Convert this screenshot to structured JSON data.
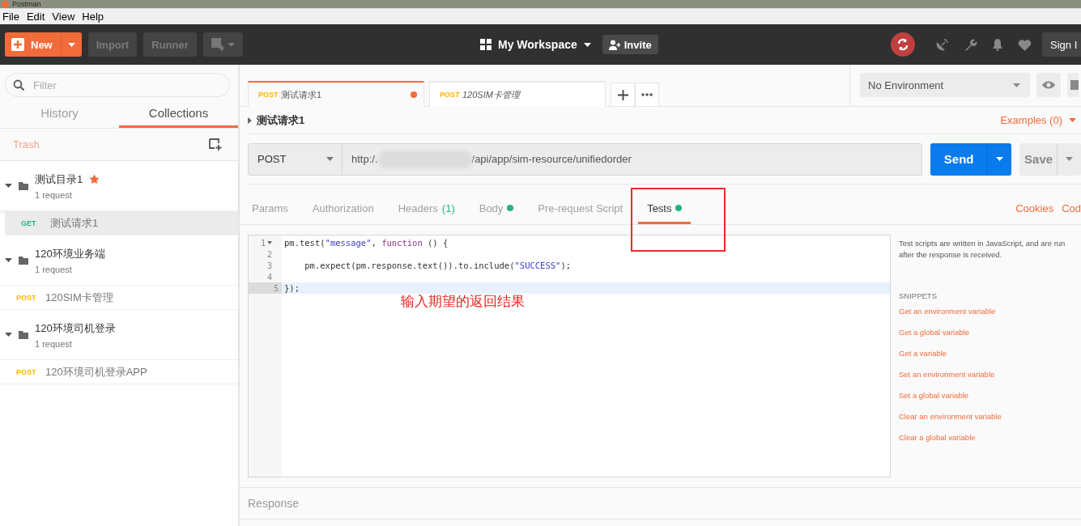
{
  "window": {
    "title": "Postman"
  },
  "menu": [
    "File",
    "Edit",
    "View",
    "Help"
  ],
  "header": {
    "new_label": "New",
    "import_label": "Import",
    "runner_label": "Runner",
    "workspace": "My Workspace",
    "invite": "Invite",
    "sign_in": "Sign I"
  },
  "sidebar": {
    "filter_placeholder": "Filter",
    "tabs": [
      {
        "label": "History",
        "selected": false
      },
      {
        "label": "Collections",
        "selected": true
      }
    ],
    "trash": "Trash",
    "collections": [
      {
        "name": "测试目录1",
        "starred": true,
        "count": "1 request",
        "expanded": true,
        "children": [
          {
            "method": "GET",
            "name": "测试请求1",
            "selected": true
          }
        ]
      },
      {
        "name": "120环境业务端",
        "starred": false,
        "count": "1 request",
        "expanded": true,
        "children": [
          {
            "method": "POST",
            "name": "120SIM卡管理",
            "selected": false
          }
        ]
      },
      {
        "name": "120环境司机登录",
        "starred": false,
        "count": "1 request",
        "expanded": true,
        "children": [
          {
            "method": "POST",
            "name": "120环境司机登录APP",
            "selected": false
          }
        ]
      }
    ]
  },
  "request_tabs": [
    {
      "method": "POST",
      "name": "测试请求1",
      "selected": true,
      "unsaved": true
    },
    {
      "method": "POST",
      "name": "120SIM卡管理",
      "selected": false,
      "unsaved": false
    }
  ],
  "environment": "No Environment",
  "request": {
    "name": "测试请求1",
    "examples": "Examples (0)",
    "method": "POST",
    "url_prefix": "http:/.",
    "url_path": "/api/app/sim-resource/unifiedorder",
    "send": "Send",
    "save": "Save"
  },
  "section_tabs": [
    {
      "label": "Params",
      "selected": false,
      "dot": false
    },
    {
      "label": "Authorization",
      "selected": false,
      "dot": false
    },
    {
      "label": "Headers",
      "count": "(1)",
      "selected": false,
      "dot": false
    },
    {
      "label": "Body",
      "selected": false,
      "dot": true
    },
    {
      "label": "Pre-request Script",
      "selected": false,
      "dot": false
    },
    {
      "label": "Tests",
      "selected": true,
      "dot": true
    }
  ],
  "section_links": [
    "Cookies",
    "Cod"
  ],
  "editor": {
    "lines": [
      {
        "number": "1",
        "foldable": true,
        "active": false,
        "tokens": [
          {
            "text": "pm.test(",
            "kind": "plain"
          },
          {
            "text": "\"message\"",
            "kind": "string"
          },
          {
            "text": ", ",
            "kind": "plain"
          },
          {
            "text": "function",
            "kind": "keyword"
          },
          {
            "text": " () {",
            "kind": "plain"
          }
        ]
      },
      {
        "number": "2",
        "foldable": false,
        "active": false
      },
      {
        "number": "3",
        "foldable": false,
        "active": false,
        "tokens": [
          {
            "text": "    pm.expect(pm.response.text()).to.include(",
            "kind": "plain"
          },
          {
            "text": "\"SUCCESS\"",
            "kind": "string"
          },
          {
            "text": ");",
            "kind": "plain"
          }
        ]
      },
      {
        "number": "4",
        "foldable": false,
        "active": false
      },
      {
        "number": "5",
        "foldable": false,
        "active": true,
        "tokens": [
          {
            "text": "});",
            "kind": "plain"
          }
        ]
      }
    ]
  },
  "annotation": "输入期望的返回结果",
  "snippets": {
    "description": "Test scripts are written in JavaScript, and are run after the response is received.",
    "heading": "SNIPPETS",
    "items": [
      "Get an environment variable",
      "Get a global variable",
      "Get a variable",
      "Set an environment variable",
      "Set a global variable",
      "Clear an environment variable",
      "Clear a global variable"
    ]
  },
  "response": {
    "label": "Response"
  }
}
